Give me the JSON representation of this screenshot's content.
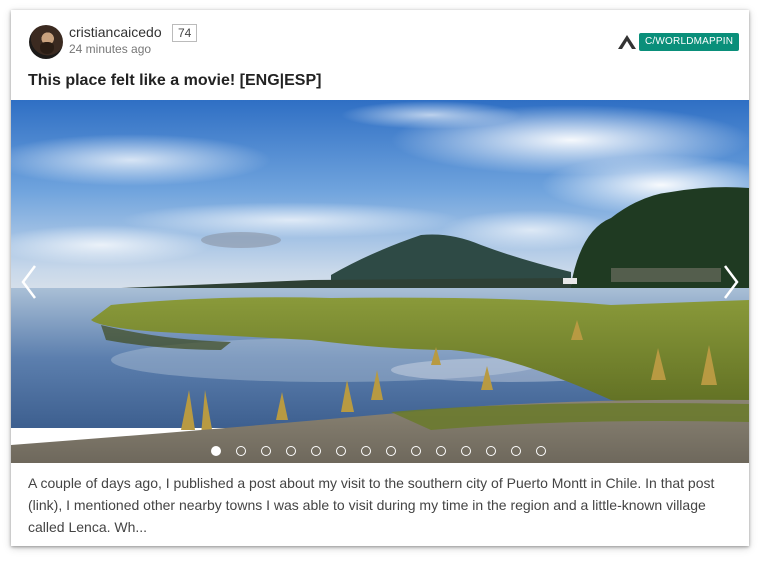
{
  "post": {
    "author": "cristiancaicedo",
    "reputation": "74",
    "time": "24 minutes ago",
    "community": "C/WORLDMAPPIN",
    "title": "This place felt like a movie! [ENG|ESP]",
    "excerpt": "A couple of days ago, I published a post about my visit to the southern city of Puerto Montt in Chile. In that post (link), I mentioned other nearby towns I was able to visit during my time in the region and a little-known village called Lenca. Wh..."
  },
  "carousel": {
    "slide_count": 14,
    "active_index": 0
  },
  "colors": {
    "community_badge": "#0a8f7a"
  }
}
